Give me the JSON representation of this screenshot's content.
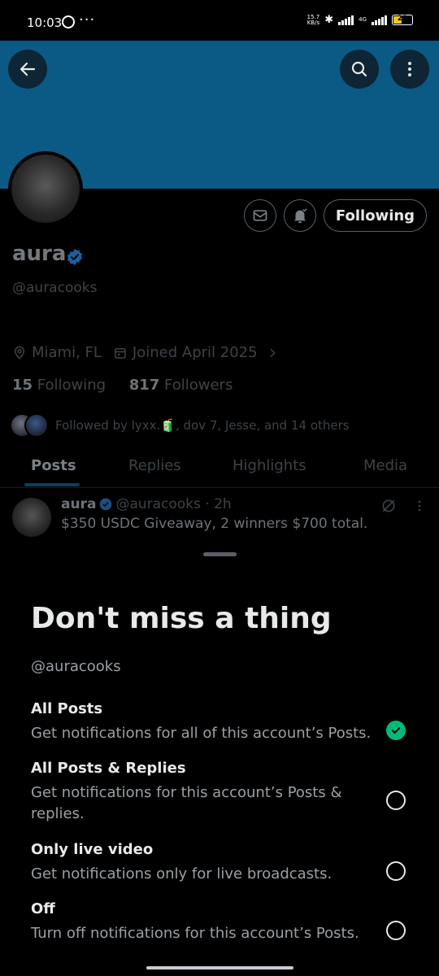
{
  "status_bar": {
    "time": "10:03",
    "more": "···",
    "speed_top": "15.7",
    "speed_bottom": "KB/s",
    "net": "4G",
    "battery": "23"
  },
  "profile": {
    "name": "aura",
    "handle": "@auracooks",
    "location": "Miami, FL",
    "joined": "Joined April 2025",
    "following_count": "15",
    "following_label": "Following",
    "followers_count": "817",
    "followers_label": "Followers",
    "followed_by": "Followed by lyxx.🧃, dov 7, Jesse, and 14 others",
    "follow_button": "Following"
  },
  "tabs": [
    {
      "label": "Posts"
    },
    {
      "label": "Replies"
    },
    {
      "label": "Highlights"
    },
    {
      "label": "Media"
    }
  ],
  "post": {
    "author": "aura",
    "meta": "@auracooks · 2h",
    "text": "$350 USDC Giveaway, 2 winners $700 total."
  },
  "sheet": {
    "title": "Don't miss a thing",
    "handle": "@auracooks",
    "options": [
      {
        "title": "All Posts",
        "desc": "Get notifications for all of this account’s Posts.",
        "selected": true
      },
      {
        "title": "All Posts & Replies",
        "desc": "Get notifications for this account’s Posts & replies.",
        "selected": false
      },
      {
        "title": "Only live video",
        "desc": "Get notifications only for live broadcasts.",
        "selected": false
      },
      {
        "title": "Off",
        "desc": "Turn off notifications for this account’s Posts.",
        "selected": false
      }
    ]
  },
  "colors": {
    "banner": "#0b5a85",
    "verified": "#1d9bf0",
    "selected": "#00ba7c"
  }
}
